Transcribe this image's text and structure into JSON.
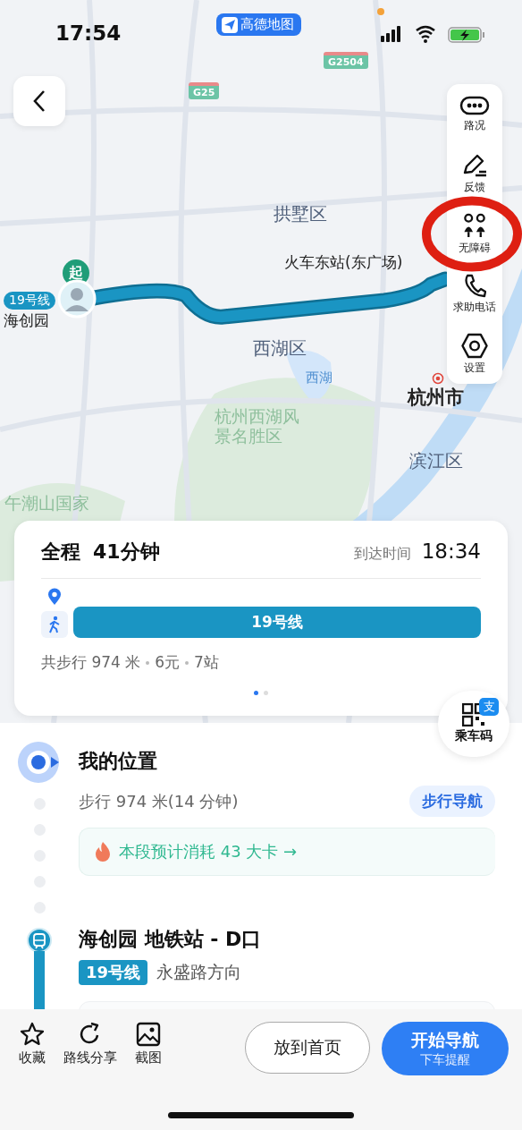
{
  "status_bar": {
    "time": "17:54",
    "app_badge": "高德地图"
  },
  "map": {
    "shields": [
      "G25",
      "G2504"
    ],
    "labels": [
      {
        "text": "拱墅区",
        "kind": "district"
      },
      {
        "text": "火车东站(东广场)",
        "kind": "poi"
      },
      {
        "text": "西湖区",
        "kind": "district"
      },
      {
        "text": "西湖",
        "kind": "water"
      },
      {
        "text": "杭州市",
        "kind": "city"
      },
      {
        "text": "杭州西湖风景名胜区",
        "kind": "scenic"
      },
      {
        "text": "滨江区",
        "kind": "district"
      },
      {
        "text": "午潮山国家",
        "kind": "scenic"
      },
      {
        "text": "海创园",
        "kind": "poi"
      }
    ],
    "start_marker": "起",
    "route_line_label": "19号线"
  },
  "side_tools": [
    {
      "label": "路况",
      "kind": "traffic"
    },
    {
      "label": "反馈",
      "kind": "feedback"
    },
    {
      "label": "无障碍",
      "kind": "accessibility"
    },
    {
      "label": "求助电话",
      "kind": "phone"
    },
    {
      "label": "设置",
      "kind": "settings"
    }
  ],
  "route_card": {
    "total_label": "全程",
    "duration": "41分钟",
    "arrival_label": "到达时间",
    "arrival_time": "18:34",
    "line_bar": "19号线",
    "summary": [
      "共步行 974 米",
      "6元",
      "7站"
    ],
    "pages": [
      {
        "selected": true
      },
      {
        "selected": false
      }
    ]
  },
  "ride_code": {
    "label": "乘车码",
    "badge": "支"
  },
  "steps": [
    {
      "kind": "origin",
      "title": "我的位置",
      "walk": "步行 974 米(14 分钟)",
      "walk_button": "步行导航",
      "calorie": "本段预计消耗 43 大卡 →"
    },
    {
      "kind": "metro",
      "title": "海创园 地铁站 - D口",
      "line_badge": "19号线",
      "direction": "永盛路方向"
    }
  ],
  "toolbar": [
    {
      "label": "收藏",
      "kind": "star"
    },
    {
      "label": "路线分享",
      "kind": "share"
    },
    {
      "label": "截图",
      "kind": "image"
    }
  ],
  "buttons": {
    "secondary": "放到首页",
    "primary": "开始导航",
    "primary_sub": "下车提醒"
  }
}
